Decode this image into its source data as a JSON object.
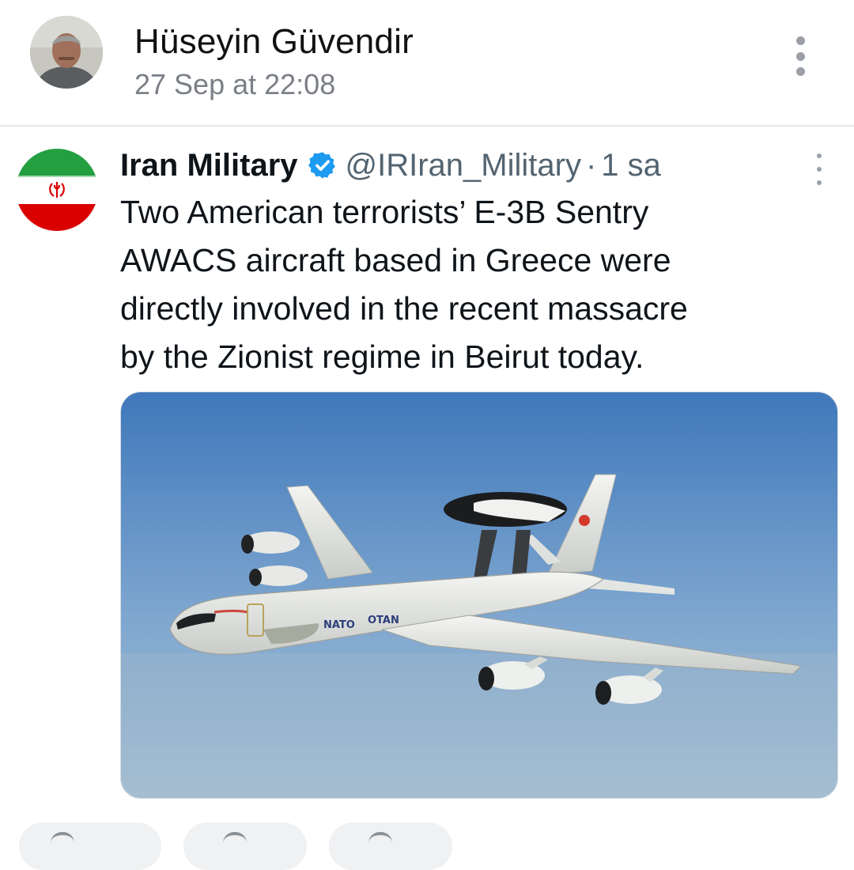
{
  "post": {
    "author_name": "Hüseyin Güvendir",
    "timestamp": "27 Sep at 22:08"
  },
  "tweet": {
    "display_name": "Iran Military",
    "handle": "@IRIran_Military",
    "separator": "·",
    "age": "1 sa",
    "text_lines": [
      "Two American terrorists’ E-3B Sentry",
      "AWACS aircraft based in Greece were",
      "directly involved in the recent massacre",
      "by the Zionist regime in Beirut today."
    ],
    "media": {
      "fuselage_marking": "NATO",
      "wing_marking": "OTAN"
    }
  },
  "colors": {
    "verified": "#1d9bf0",
    "flag_green": "#239f40",
    "flag_red": "#da0000",
    "sky_top": "#4f86c4",
    "sky_bottom": "#9db9d2"
  },
  "icons": {
    "post_menu": "more-vertical-icon",
    "tweet_menu": "more-vertical-icon",
    "verified": "verified-badge-icon"
  }
}
